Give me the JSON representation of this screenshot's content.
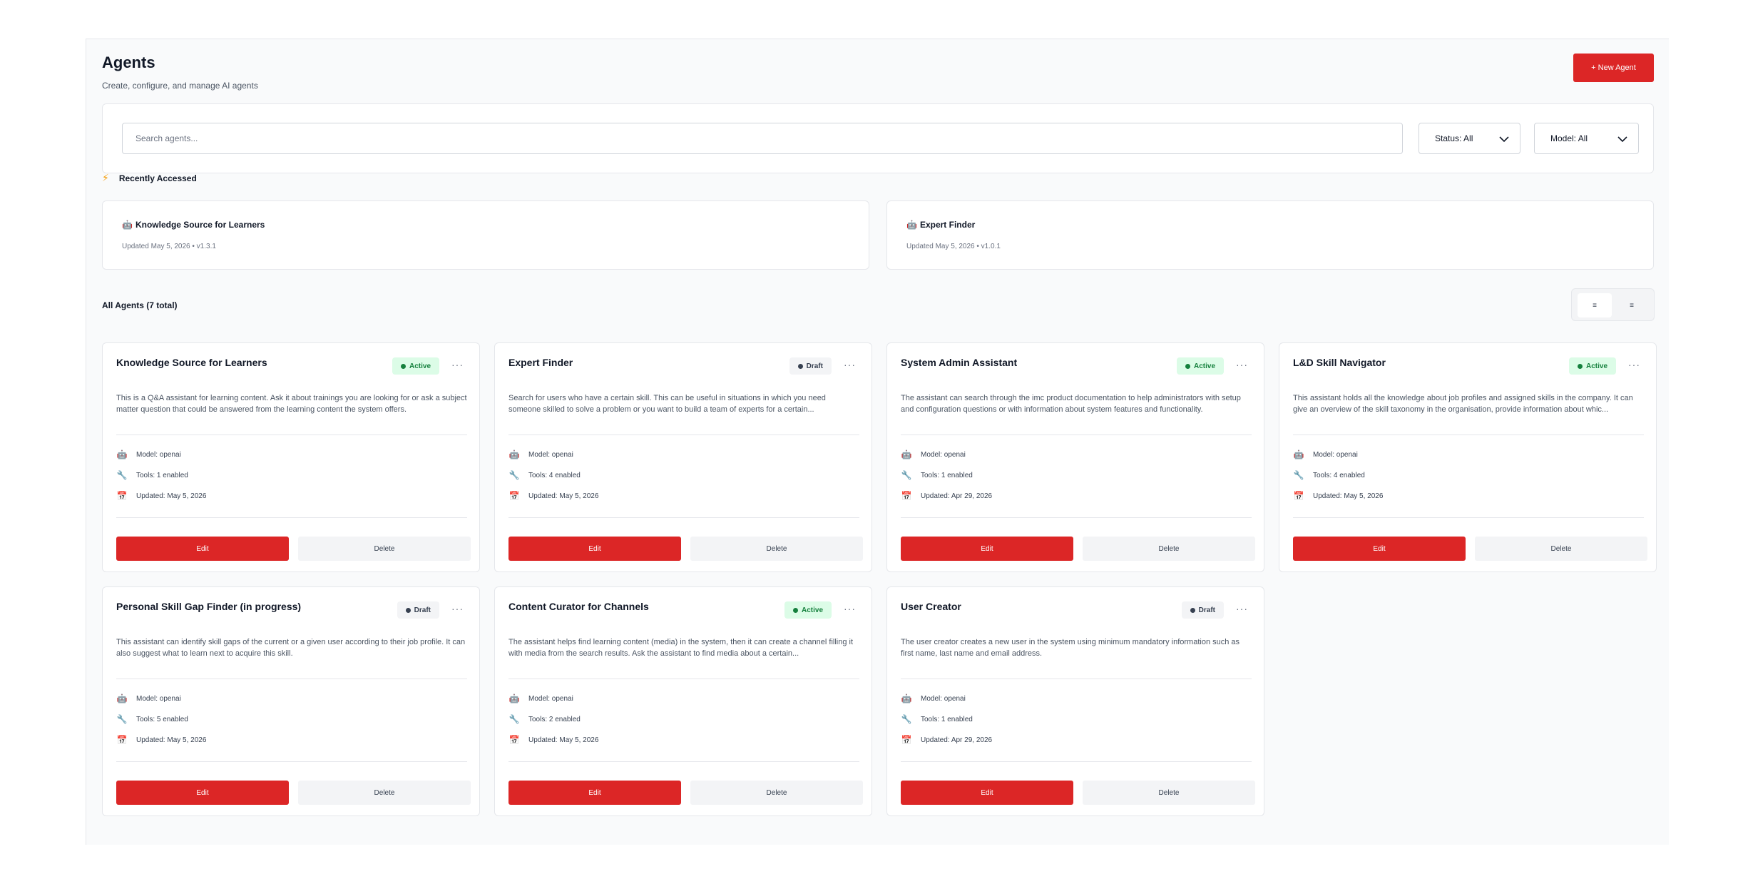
{
  "header": {
    "title": "Agents",
    "subtitle": "Create, configure, and manage AI agents",
    "new_agent_label": "+ New Agent"
  },
  "filters": {
    "search_placeholder": "Search agents...",
    "status_label": "Status: All",
    "model_label": "Model: All"
  },
  "recent": {
    "heading": "Recently Accessed",
    "icon": "lightning-bolt-icon",
    "items": [
      {
        "icon": "🤖",
        "title": "Knowledge Source for Learners",
        "meta": "Updated May 5, 2026 • v1.3.1"
      },
      {
        "icon": "🤖",
        "title": "Expert Finder",
        "meta": "Updated May 5, 2026 • v1.0.1"
      }
    ]
  },
  "all_agents": {
    "heading": "All Agents (7 total)",
    "view_toggle": {
      "grid_label": "≡",
      "list_label": "≡"
    }
  },
  "labels": {
    "edit": "Edit",
    "delete": "Delete",
    "more": "···"
  },
  "colors": {
    "accent": "#dc2626",
    "active_bg": "#dcfce7",
    "active_fg": "#15803d",
    "draft_bg": "#f3f4f6"
  },
  "agents": [
    {
      "title": "Knowledge Source for Learners",
      "status": "Active",
      "description": "This is a Q&A assistant for learning content. Ask it about trainings you are looking for or ask a subject matter question that could be answered from the learning content the system offers.",
      "model": "Model: openai",
      "tools": "Tools: 1 enabled",
      "updated": "Updated: May 5, 2026"
    },
    {
      "title": "Expert Finder",
      "status": "Draft",
      "description": "Search for users who have a certain skill. This can be useful in situations in which you need someone skilled to solve a problem or you want to build a team of experts for a certain...",
      "model": "Model: openai",
      "tools": "Tools: 4 enabled",
      "updated": "Updated: May 5, 2026"
    },
    {
      "title": "System Admin Assistant",
      "status": "Active",
      "description": "The assistant can search through the imc product documentation to help administrators with setup and configuration questions or with information about system features and functionality.",
      "model": "Model: openai",
      "tools": "Tools: 1 enabled",
      "updated": "Updated: Apr 29, 2026"
    },
    {
      "title": "L&D Skill Navigator",
      "status": "Active",
      "description": "This assistant holds all the knowledge about job profiles and assigned skills in the company. It can give an overview of the skill taxonomy in the organisation, provide information about whic...",
      "model": "Model: openai",
      "tools": "Tools: 4 enabled",
      "updated": "Updated: May 5, 2026"
    },
    {
      "title": "Personal Skill Gap Finder (in progress)",
      "status": "Draft",
      "description": "This assistant can identify skill gaps of the current or a given user according to their job profile. It can also suggest what to learn next to acquire this skill.",
      "model": "Model: openai",
      "tools": "Tools: 5 enabled",
      "updated": "Updated: May 5, 2026"
    },
    {
      "title": "Content Curator for Channels",
      "status": "Active",
      "description": "The assistant helps find learning content (media) in the system, then it can create a channel filling it with media from the search results. Ask the assistant to find media about a certain...",
      "model": "Model: openai",
      "tools": "Tools: 2 enabled",
      "updated": "Updated: May 5, 2026"
    },
    {
      "title": "User Creator",
      "status": "Draft",
      "description": "The user creator creates a new user in the system using minimum mandatory information such as first name, last name and email address.",
      "model": "Model: openai",
      "tools": "Tools: 1 enabled",
      "updated": "Updated: Apr 29, 2026"
    }
  ]
}
